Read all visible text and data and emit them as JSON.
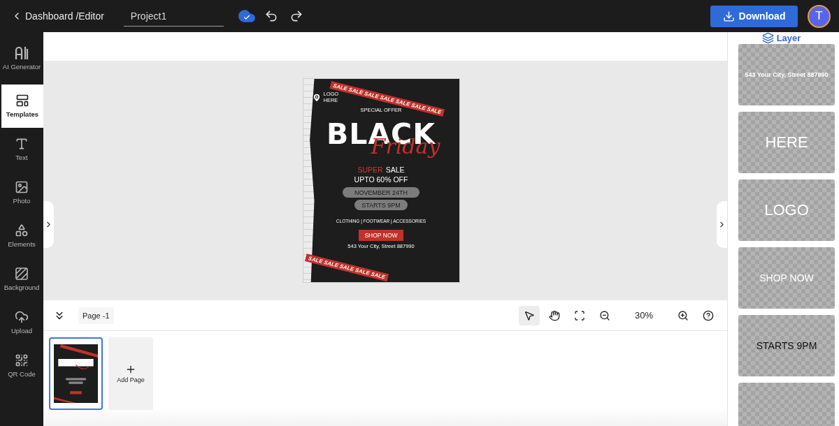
{
  "topbar": {
    "breadcrumb": "Dashboard /Editor",
    "project_name": "Project1",
    "download": "Download",
    "avatar": "T"
  },
  "sidebar": {
    "items": [
      {
        "label": "AI Generator",
        "selected": false
      },
      {
        "label": "Templates",
        "selected": true
      },
      {
        "label": "Text",
        "selected": false
      },
      {
        "label": "Photo",
        "selected": false
      },
      {
        "label": "Elements",
        "selected": false
      },
      {
        "label": "Background",
        "selected": false
      },
      {
        "label": "Upload",
        "selected": false
      },
      {
        "label": "QR Code",
        "selected": false
      }
    ]
  },
  "poster": {
    "ribbon_top": "SALE SALE SALE SALE SALE SALE SALE",
    "ribbon_bottom": "SALE SALE SALE SALE SALE",
    "logo_line1": "LOGO",
    "logo_line2": "HERE",
    "special_offer": "SPECIAL OFFER",
    "title": "BLACK",
    "script": "Friday",
    "super_word": "SUPER",
    "sale_word": "SALE",
    "discount": "UPTO 60% OFF",
    "date": "NOVEMBER 24TH",
    "time": "STARTS 9PM",
    "categories": "CLOTHING | FOOTWEAR | ACCESSORIES",
    "cta": "SHOP NOW",
    "address": "543 Your City, Street 887990"
  },
  "bottom_toolbar": {
    "page_label": "Page -1",
    "zoom": "30%",
    "tools": [
      {
        "selected": true
      },
      {
        "selected": false
      },
      {
        "selected": false
      },
      {
        "selected": false
      }
    ]
  },
  "pages": {
    "thumbnails": [
      {
        "selected": true
      }
    ],
    "add_label": "Add Page"
  },
  "layer_panel": {
    "title": "Layer",
    "layers": [
      {
        "text": "543 Your City, Street 887990",
        "color": "#ffffff"
      },
      {
        "text": "HERE",
        "color": "#ffffff"
      },
      {
        "text": "LOGO",
        "color": "#ffffff"
      },
      {
        "text": "SHOP NOW",
        "color": "#ffffff"
      },
      {
        "text": "STARTS 9PM",
        "color": "#111111"
      }
    ]
  }
}
